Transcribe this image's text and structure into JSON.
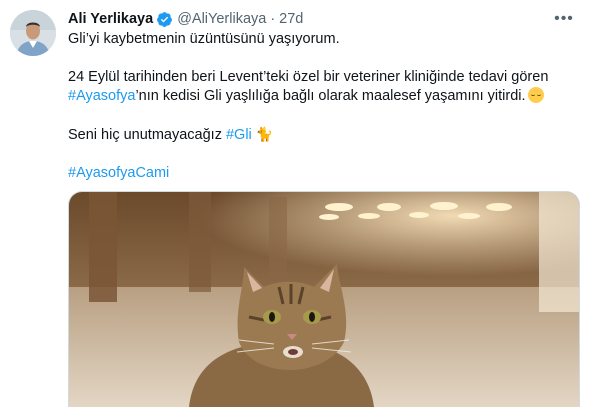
{
  "tweet": {
    "author_name": "Ali Yerlikaya",
    "handle": "@AliYerlikaya",
    "separator": "·",
    "time": "27d",
    "more_label": "•••",
    "line1": "Gli’yi kaybetmenin üzüntüsünü yaşıyorum.",
    "line2": "24 Eylül tarihinden beri Levent’teki özel bir veteriner kliniğinde tedavi gören",
    "hashtag_ayasofya": "#Ayasofya",
    "line3_rest": "’nın kedisi Gli yaşlılığa bağlı olarak maalesef yaşamını yitirdi.",
    "line4": "Seni hiç unutmayacağız ",
    "hashtag_gli": "#Gli",
    "cat_emoji": "🐈",
    "hashtag_ayasofyacami": "#AyasofyaCami"
  },
  "icons": {
    "avatar": "avatar-photo",
    "verified": "verified-badge-icon",
    "more": "more-options-icon",
    "sad_emoji": "pensive-face-emoji"
  },
  "colors": {
    "link": "#1d9bf0",
    "text": "#0f1419",
    "secondary": "#536471"
  }
}
